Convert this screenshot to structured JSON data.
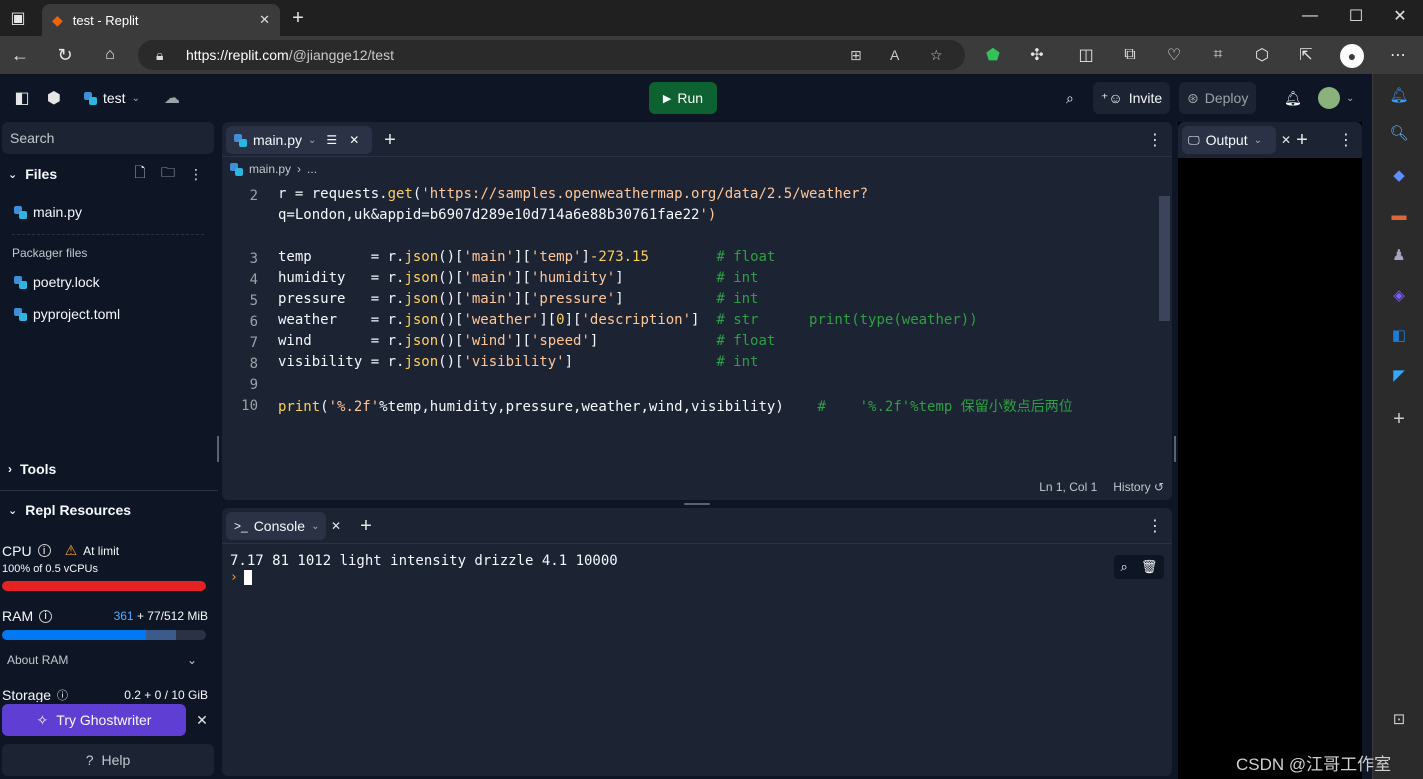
{
  "browser": {
    "tab_title": "test - Replit",
    "url_host": "https://replit.com",
    "url_path": "/@jiangge12/test",
    "colors": {
      "chrome_dark": "#202020",
      "chrome": "#3b3b3b"
    }
  },
  "topbar": {
    "repl_name": "test",
    "run_label": "Run",
    "invite_label": "Invite",
    "deploy_label": "Deploy"
  },
  "sidebar": {
    "search_placeholder": "Search",
    "files_title": "Files",
    "files": [
      {
        "name": "main.py"
      }
    ],
    "packager_title": "Packager files",
    "packager_files": [
      {
        "name": "poetry.lock"
      },
      {
        "name": "pyproject.toml"
      }
    ],
    "tools_title": "Tools",
    "resources_title": "Repl Resources",
    "cpu_label": "CPU",
    "cpu_status": "At limit",
    "cpu_detail": "100% of 0.5 vCPUs",
    "cpu_usage": 1.0,
    "ram_label": "RAM",
    "ram_used": "361",
    "ram_detail": "+ 77/512 MiB",
    "ram_usage": 0.705,
    "ram_cache": 0.15,
    "about_ram": "About RAM",
    "storage_label": "Storage",
    "storage_detail": "0.2 + 0 / 10 GiB",
    "ghostwriter_label": "Try Ghostwriter",
    "help_label": "Help"
  },
  "editor": {
    "tab_label": "main.py",
    "breadcrumb_file": "main.py",
    "breadcrumb_more": "...",
    "cursor_pos": "Ln 1, Col 1",
    "history_label": "History",
    "lines": [
      {
        "n": "2",
        "code": "r = requests.get('https://samples.openweathermap.org/data/2.5/weather?"
      },
      {
        "n": "",
        "code": "q=London,uk&appid=b6907d289e10d714a6e88b30761fae22')"
      },
      {
        "n": "3",
        "code": "temp       = r.json()['main']['temp']-273.15        # float"
      },
      {
        "n": "4",
        "code": "humidity   = r.json()['main']['humidity']           # int"
      },
      {
        "n": "5",
        "code": "pressure   = r.json()['main']['pressure']           # int"
      },
      {
        "n": "6",
        "code": "weather    = r.json()['weather'][0]['description']  # str      print(type(weather))"
      },
      {
        "n": "7",
        "code": "wind       = r.json()['wind']['speed']              # float"
      },
      {
        "n": "8",
        "code": "visibility = r.json()['visibility']                 # int"
      },
      {
        "n": "9",
        "code": ""
      },
      {
        "n": "10",
        "code": "print('%.2f'%temp,humidity,pressure,weather,wind,visibility)    #    '%.2f'%temp 保留小数点后两位"
      }
    ]
  },
  "console": {
    "tab_label": "Console",
    "output_line": "7.17 81 1012 light intensity drizzle 4.1 10000",
    "prompt": "›"
  },
  "output": {
    "tab_label": "Output"
  },
  "watermark": "CSDN @江哥工作室"
}
